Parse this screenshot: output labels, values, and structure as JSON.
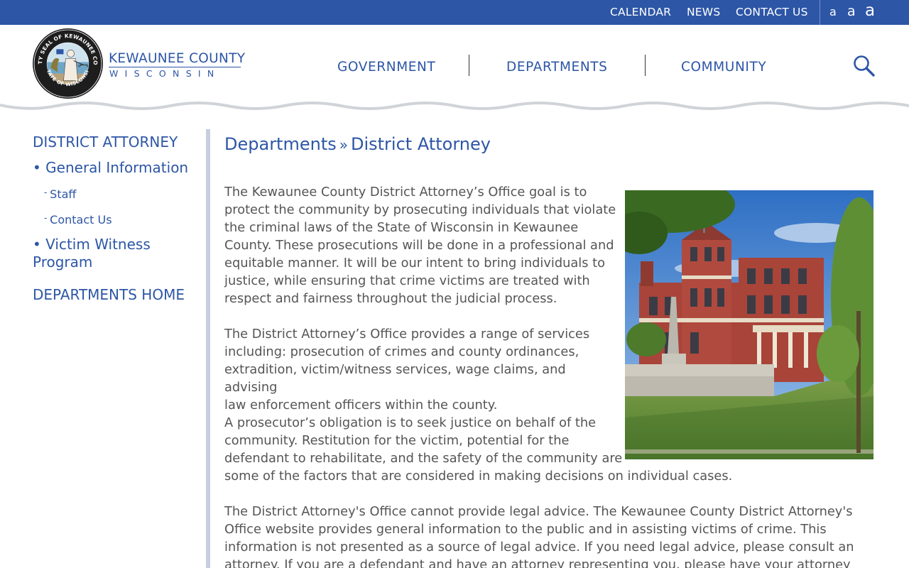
{
  "utility_nav": {
    "links": [
      "CALENDAR",
      "NEWS",
      "CONTACT US"
    ],
    "font_size_small": "a",
    "font_size_medium": "a",
    "font_size_large": "a"
  },
  "header": {
    "logo_line1": "KEWAUNEE COUNTY",
    "logo_line2": "WISCONSIN",
    "seal_text_top": "COUNTY SEAL OF KEWAUNEE COUNTY",
    "seal_text_bottom": "STATE OF WISCONSIN",
    "nav": [
      "GOVERNMENT",
      "DEPARTMENTS",
      "COMMUNITY"
    ],
    "search_icon": "search-icon"
  },
  "sidebar": {
    "section_title": "DISTRICT ATTORNEY",
    "general_information": "General Information",
    "staff": "Staff",
    "contact_us": "Contact Us",
    "victim_witness_line1": "Victim Witness",
    "victim_witness_line2": "Program",
    "departments_home": "DEPARTMENTS HOME"
  },
  "breadcrumb": {
    "parent": "Departments",
    "separator": "»",
    "current": "District Attorney"
  },
  "content": {
    "p1": [
      "The Kewaunee County District Attorney’s Office goal is to",
      "protect the community by prosecuting individuals that violate",
      "the criminal laws of the State of Wisconsin in Kewaunee",
      "County. These prosecutions will be done in a professional and",
      "equitable manner. It will be our intent to bring individuals to",
      "justice, while ensuring that crime victims are treated with",
      "respect and fairness throughout the judicial process."
    ],
    "p2": [
      "The District Attorney’s Office provides a range of services",
      "including: prosecution of crimes and county ordinances,",
      "extradition, victim/witness services, wage claims, and advising",
      "law enforcement officers within the county."
    ],
    "p3": [
      "A prosecutor’s obligation is to seek justice on behalf of the",
      "community. Restitution for the victim, potential for the",
      "defendant to rehabilitate, and the safety of the community are",
      "some of the factors that are considered in making decisions on individual cases."
    ],
    "p4": [
      "The District Attorney's Office cannot provide legal advice. The Kewaunee County District Attorney's",
      "Office website provides general information to the public and in assisting victims of crime. This",
      "information is not presented as a source of legal advice. If you need legal advice, please consult an",
      "attorney. If you are a defendant and have an attorney representing you, please have your attorney"
    ]
  },
  "colors": {
    "brand_blue": "#2d56a6",
    "body_text": "#555555",
    "sidebar_rule": "#c5cfe0",
    "topbar": "#2d56a6"
  }
}
